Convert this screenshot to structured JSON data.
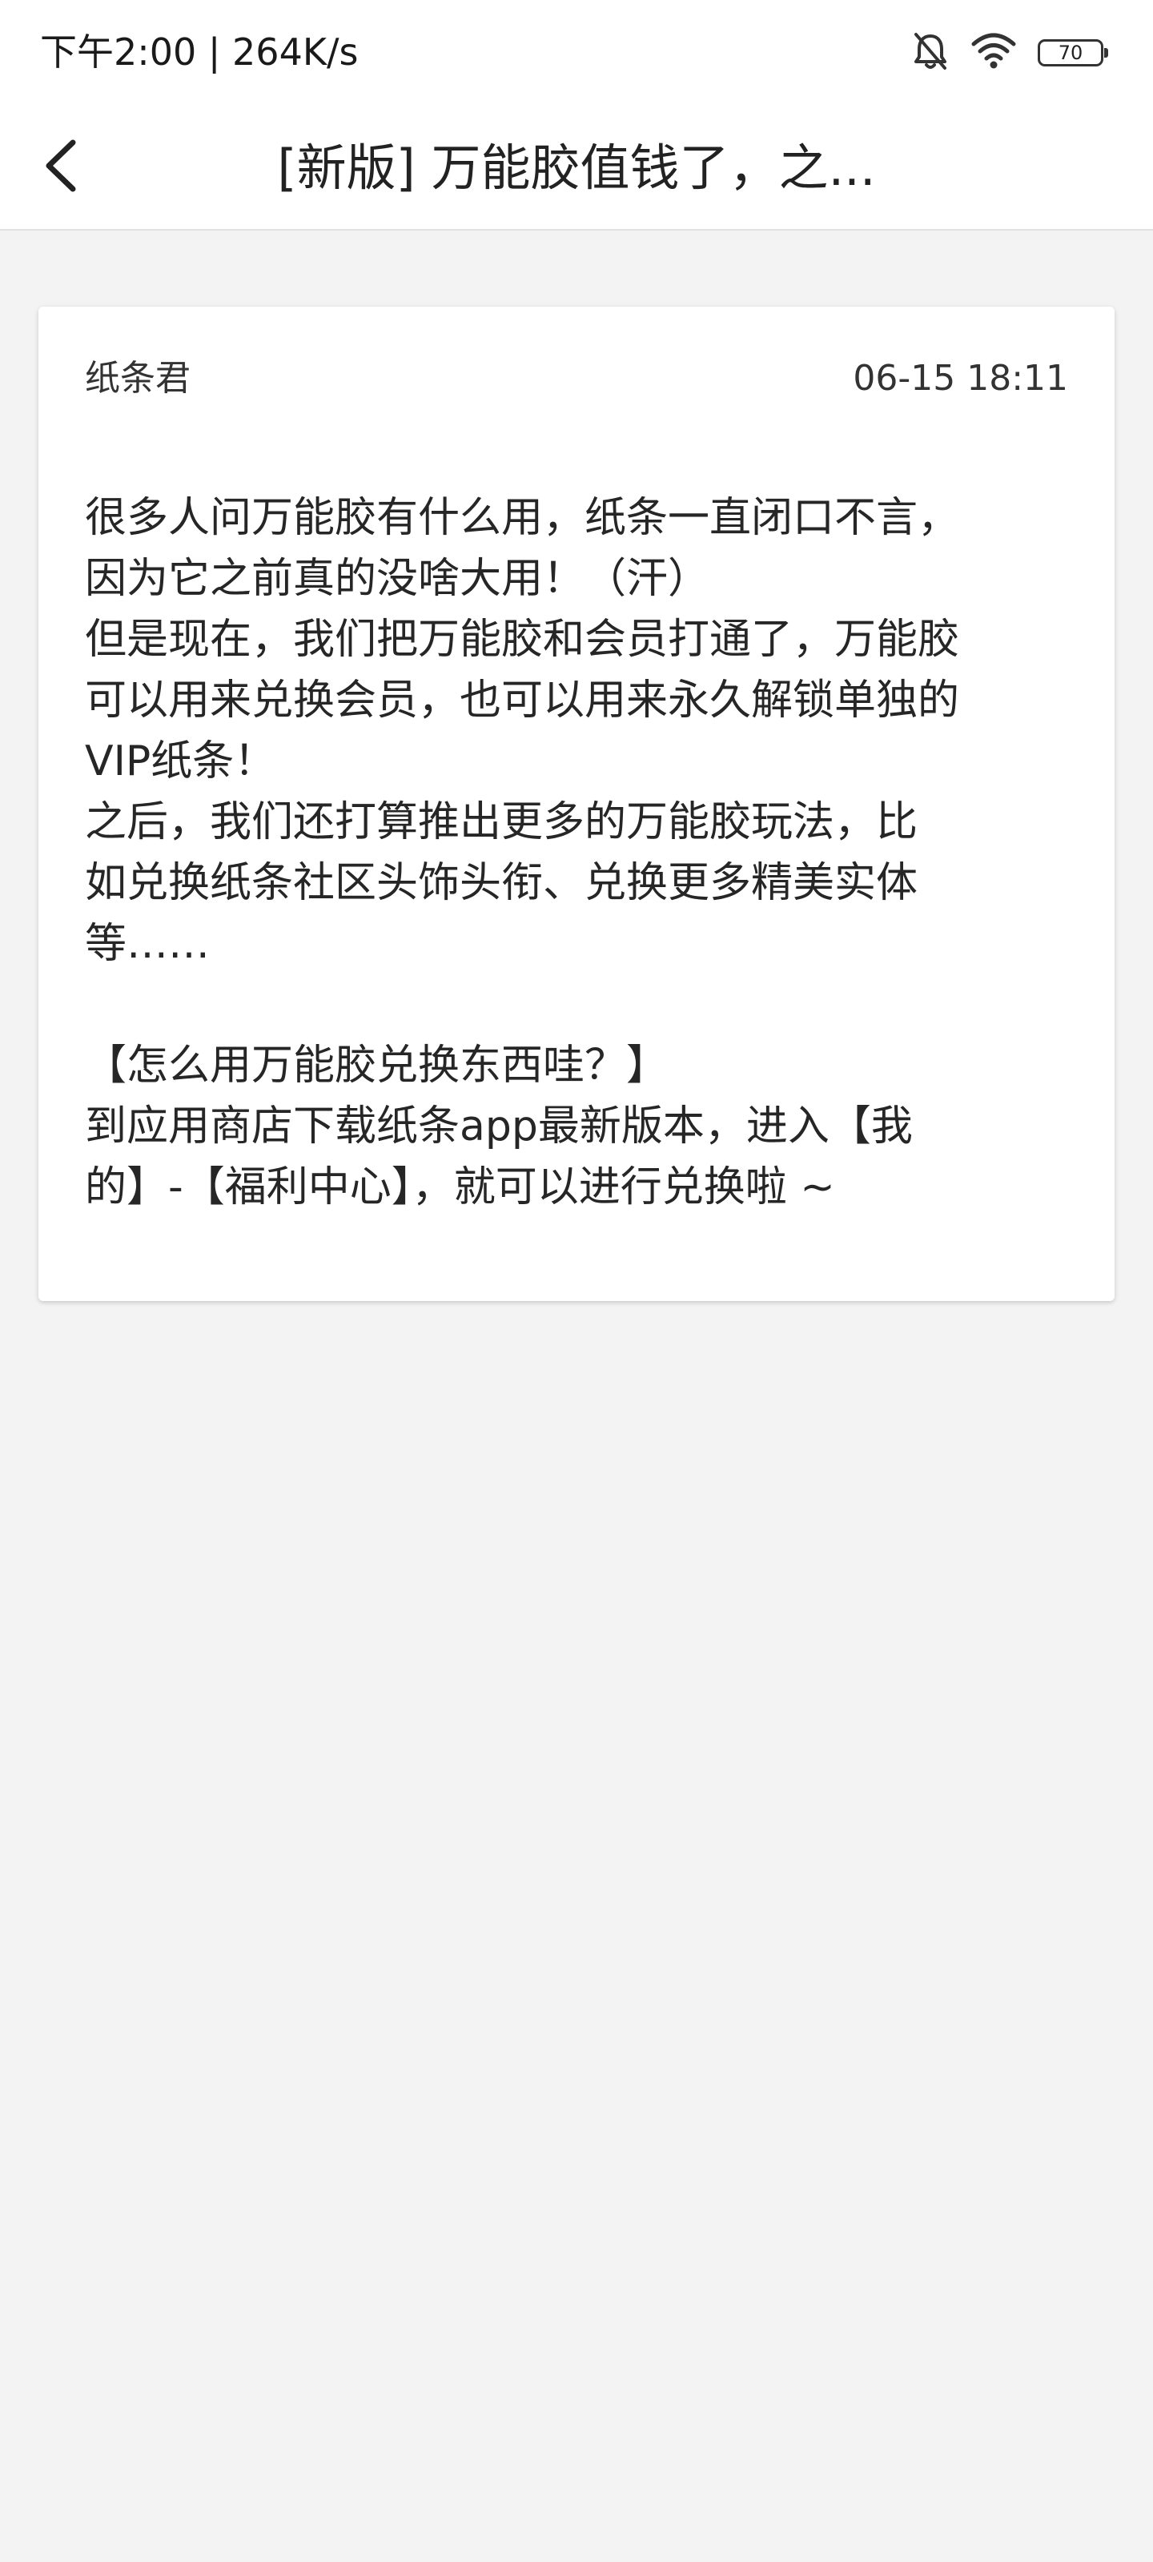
{
  "status_bar": {
    "time_speed": "下午2:00 | 264K/s",
    "battery": "70"
  },
  "nav": {
    "title": "[新版] 万能胶值钱了，之..."
  },
  "post": {
    "author": "纸条君",
    "time": "06-15 18:11",
    "lines": [
      "很多人问万能胶有什么用，纸条一直闭口不言，",
      "因为它之前真的没啥大用！（汗）",
      "但是现在，我们把万能胶和会员打通了，万能胶",
      "可以用来兑换会员，也可以用来永久解锁单独的",
      "VIP纸条！",
      "之后，我们还打算推出更多的万能胶玩法，比",
      "如兑换纸条社区头饰头衔、兑换更多精美实体",
      "等……",
      "",
      "【怎么用万能胶兑换东西哇？】",
      "到应用商店下载纸条app最新版本，进入【我",
      "的】-【福利中心】，就可以进行兑换啦 ~"
    ]
  },
  "icons": {
    "silent": "bell-off-icon",
    "wifi": "wifi-icon",
    "battery": "battery-icon",
    "back": "chevron-left-icon"
  }
}
